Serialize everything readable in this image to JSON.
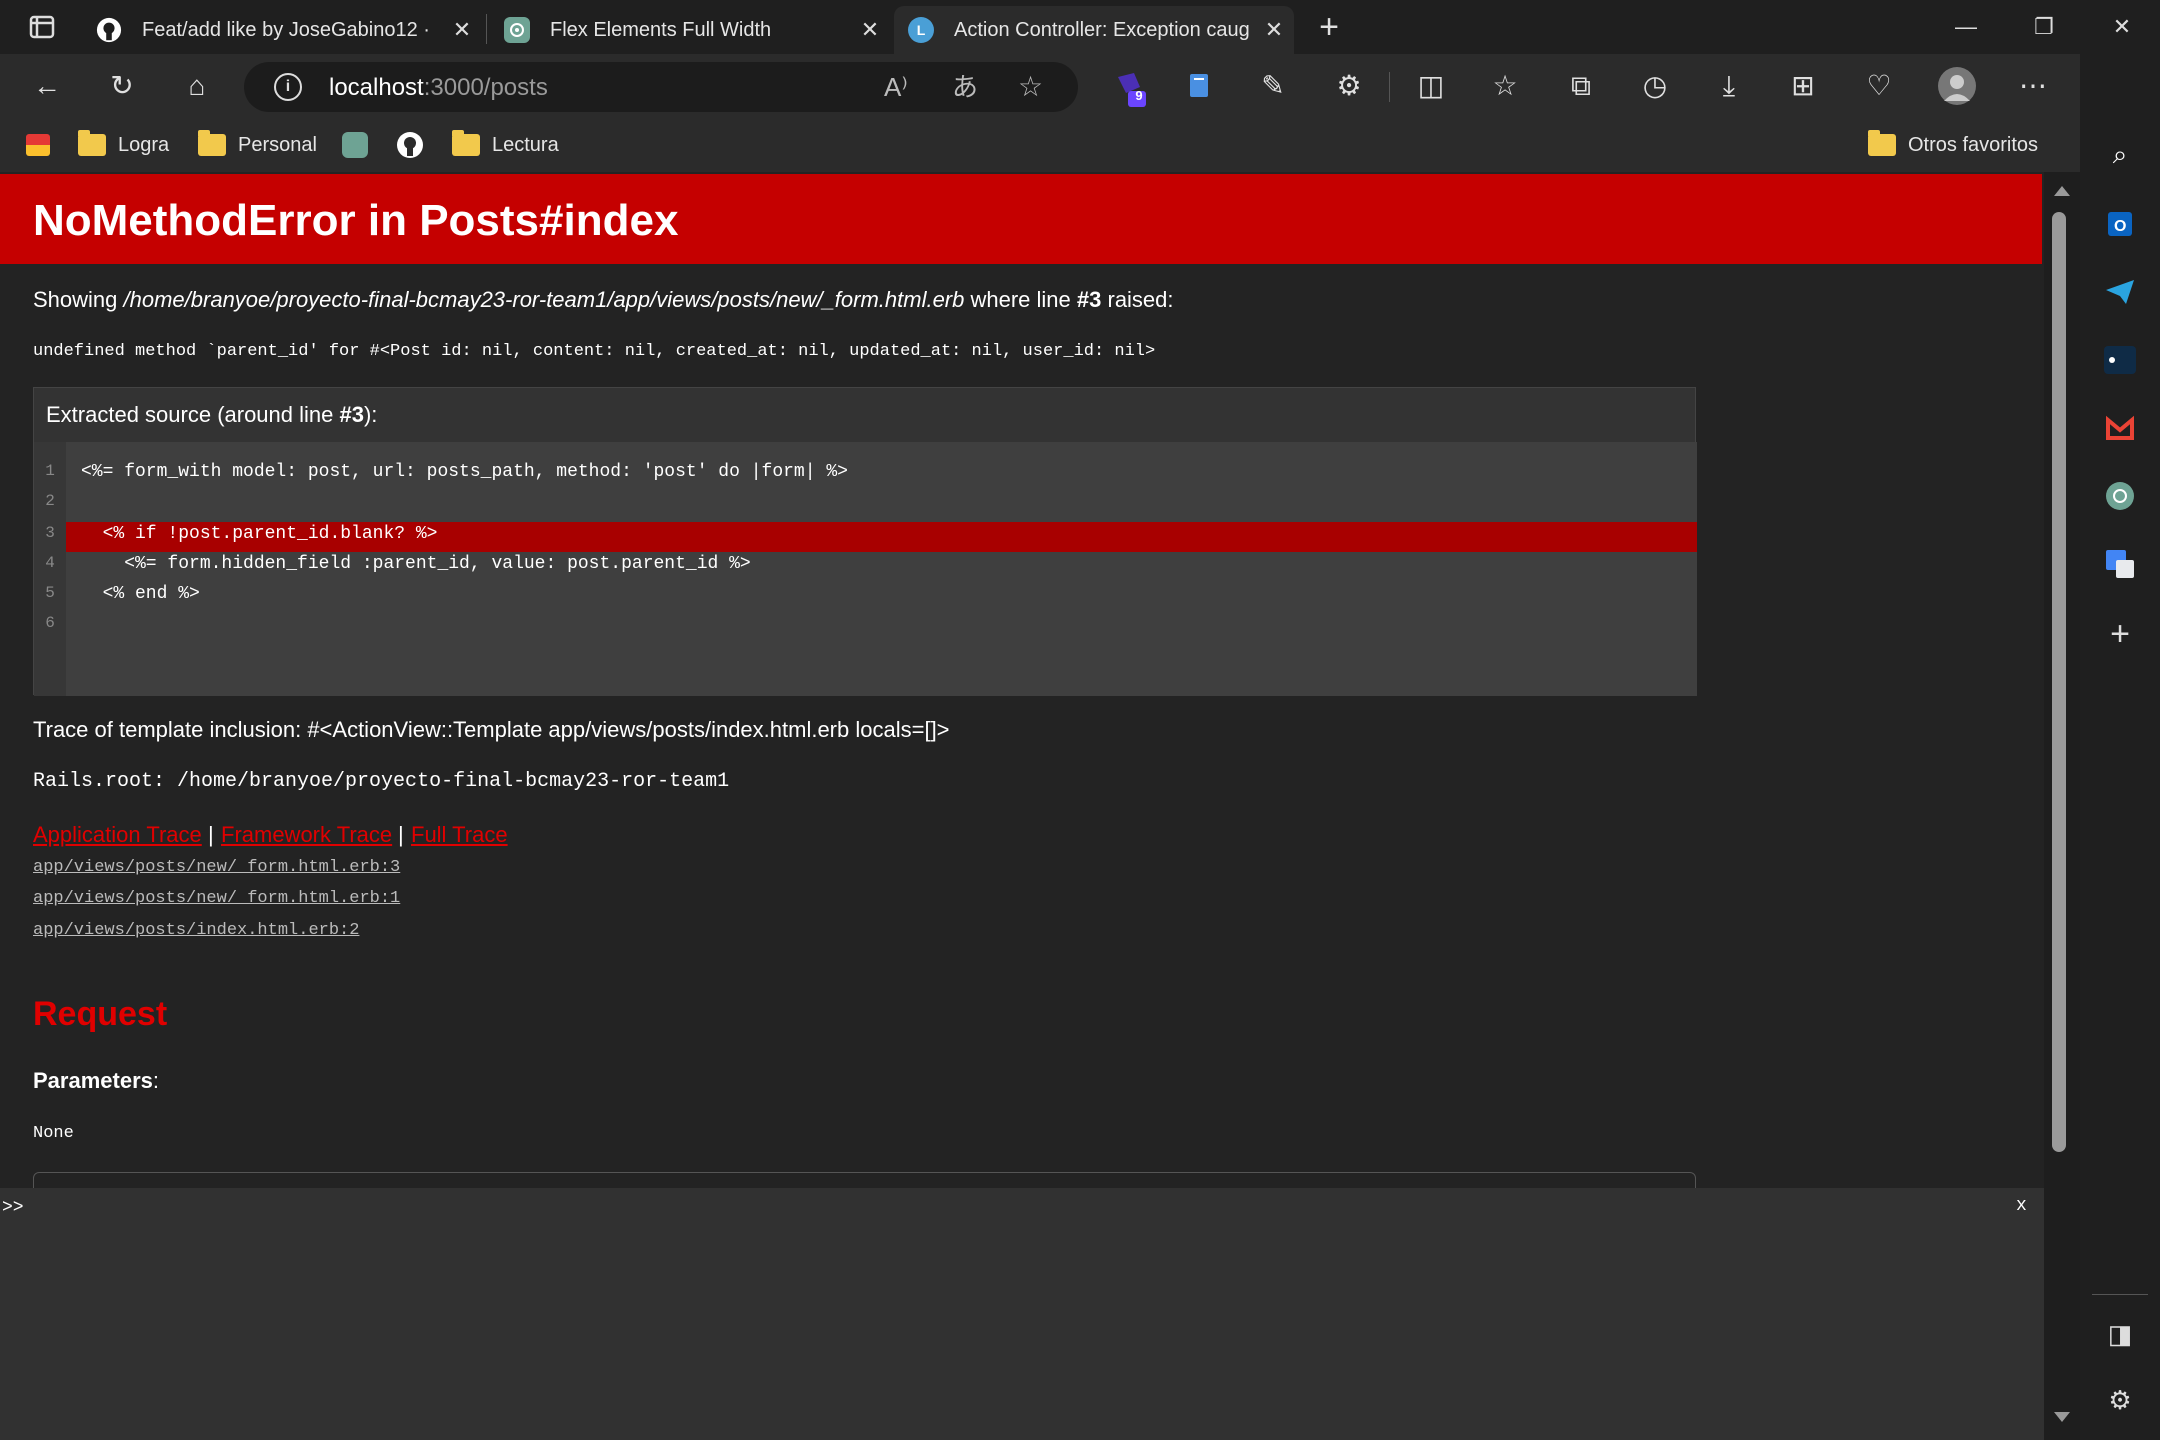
{
  "tabs": [
    {
      "title": "Feat/add like by JoseGabino12 · ",
      "icon": "github-icon"
    },
    {
      "title": "Flex Elements Full Width",
      "icon": "chatgpt-icon"
    },
    {
      "title": "Action Controller: Exception caug",
      "icon": "loading-icon"
    }
  ],
  "address": {
    "host": "localhost",
    "path": ":3000/posts"
  },
  "badge": "9",
  "bookmarks": [
    "Logra",
    "Personal",
    "Lectura"
  ],
  "other_favorites": "Otros favoritos",
  "error": {
    "title": "NoMethodError in Posts#index",
    "showing_prefix": "Showing ",
    "file": "/home/branyoe/proyecto-final-bcmay23-ror-team1/app/views/posts/new/_form.html.erb",
    "where_line": " where line ",
    "line_no": "#3",
    "raised": " raised:",
    "message": "undefined method `parent_id' for #<Post id: nil, content: nil, created_at: nil, updated_at: nil, user_id: nil>",
    "source_title_prefix": "Extracted source (around line ",
    "source_title_line": "#3",
    "source_title_suffix": "):",
    "source_lines": [
      {
        "n": "1",
        "code": "<%= form_with model: post, url: posts_path, method: 'post' do |form| %>"
      },
      {
        "n": "2",
        "code": ""
      },
      {
        "n": "3",
        "code": "  <% if !post.parent_id.blank? %>"
      },
      {
        "n": "4",
        "code": "    <%= form.hidden_field :parent_id, value: post.parent_id %>"
      },
      {
        "n": "5",
        "code": "  <% end %>"
      },
      {
        "n": "6",
        "code": ""
      }
    ],
    "trace_inclusion": "Trace of template inclusion: #<ActionView::Template app/views/posts/index.html.erb locals=[]>",
    "rails_root": "Rails.root: /home/branyoe/proyecto-final-bcmay23-ror-team1",
    "trace_links": [
      "Application Trace",
      "Framework Trace",
      "Full Trace"
    ],
    "trace_sep": "|",
    "traces": [
      "app/views/posts/new/_form.html.erb:3",
      "app/views/posts/new/_form.html.erb:1",
      "app/views/posts/index.html.erb:2"
    ],
    "request_heading": "Request",
    "parameters_label": "Parameters",
    "parameters_colon": ":",
    "parameters_value": "None"
  },
  "console": {
    "prompt": ">>",
    "close": "x"
  }
}
